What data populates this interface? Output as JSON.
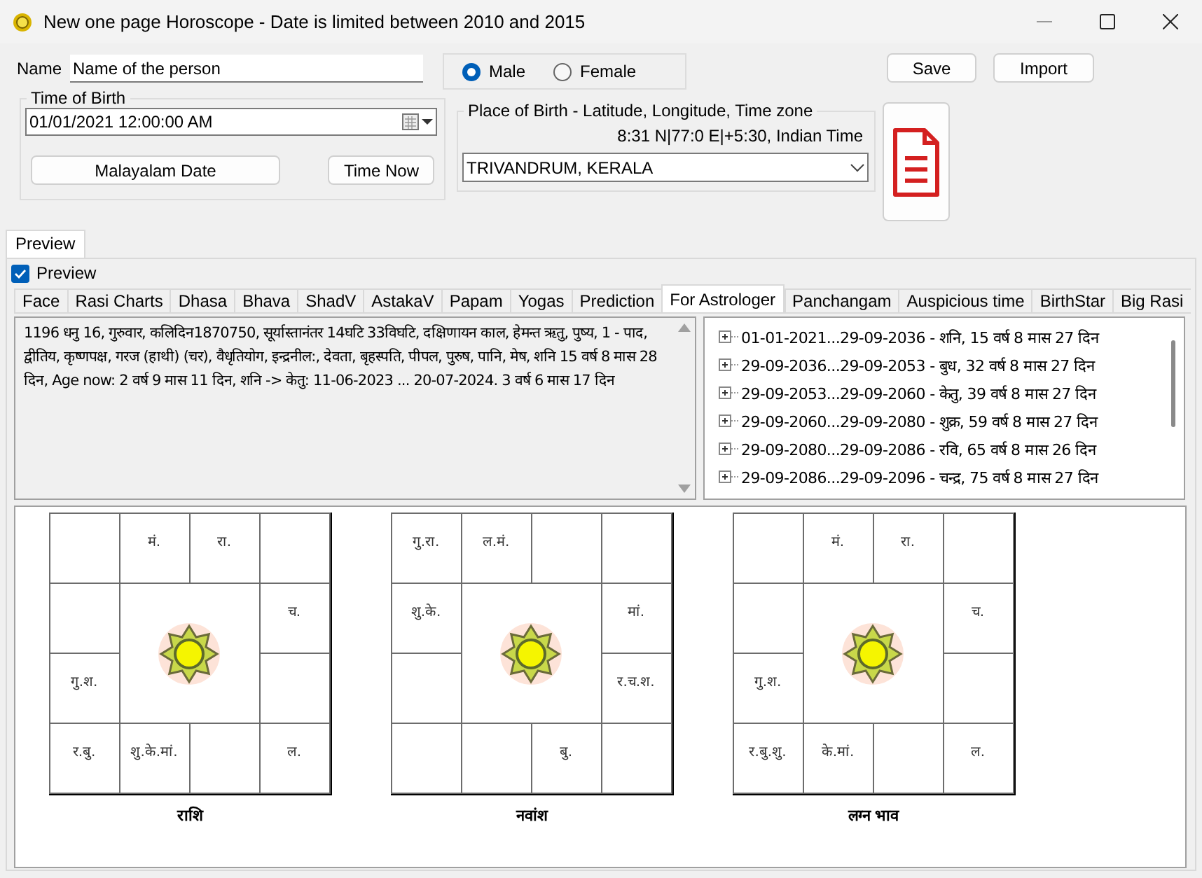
{
  "window": {
    "title": "New one page Horoscope - Date is limited between 2010 and 2015"
  },
  "name": {
    "label": "Name",
    "value": "Name of the person"
  },
  "gender": [
    {
      "label": "Male",
      "selected": true
    },
    {
      "label": "Female",
      "selected": false
    }
  ],
  "buttons": {
    "save": "Save",
    "import": "Import"
  },
  "time_of_birth": {
    "title": "Time of Birth",
    "value": "01/01/2021  12:00:00 AM",
    "malayalam_button": "Malayalam Date",
    "time_now_button": "Time Now"
  },
  "place_of_birth": {
    "title": "Place of Birth - Latitude, Longitude, Time zone",
    "coordinates": "8:31 N|77:0 E|+5:30, Indian Time",
    "place": "TRIVANDRUM, KERALA"
  },
  "outer_tabs": [
    {
      "label": "Preview",
      "selected": true
    }
  ],
  "preview_checkbox": {
    "label": "Preview",
    "checked": true
  },
  "tabs": [
    {
      "label": "Face",
      "selected": false
    },
    {
      "label": "Rasi Charts",
      "selected": false
    },
    {
      "label": "Dhasa",
      "selected": false
    },
    {
      "label": "Bhava",
      "selected": false
    },
    {
      "label": "ShadV",
      "selected": false
    },
    {
      "label": "AstakaV",
      "selected": false
    },
    {
      "label": "Papam",
      "selected": false
    },
    {
      "label": "Yogas",
      "selected": false
    },
    {
      "label": "Prediction",
      "selected": false
    },
    {
      "label": "For Astrologer",
      "selected": true
    },
    {
      "label": "Panchangam",
      "selected": false
    },
    {
      "label": "Auspicious time",
      "selected": false
    },
    {
      "label": "BirthStar",
      "selected": false
    },
    {
      "label": "Big Rasi",
      "selected": false
    }
  ],
  "summary": "1196 धनु   16, गुरुवार, कलिदिन1870750, सूर्यास्तानंतर 14घटि 33विघटि, दक्षिणायन काल, हेमन्त ऋतु, पुष्य, 1 - पाद, द्वीतिय, कृष्णपक्ष, गरज (हाथी) (चर), वैधृतियोग, इन्द्रनील:, देवता, बृहस्पति, पीपल, पुरुष, पानि, मेष, शनि 15 वर्ष 8 मास 28 दिन, Age now: 2 वर्ष 9 मास 11 दिन, शनि -> केतु: 11-06-2023 ... 20-07-2024.  3 वर्ष 6 मास 17 दिन",
  "dasha_periods": [
    {
      "text": "01-01-2021...29-09-2036 - शनि, 15 वर्ष 8 मास 27 दिन",
      "expanded": false
    },
    {
      "text": "29-09-2036...29-09-2053 - बुध, 32 वर्ष 8 मास 27 दिन",
      "expanded": false
    },
    {
      "text": "29-09-2053...29-09-2060 - केतु, 39 वर्ष 8 मास 27 दिन",
      "expanded": false
    },
    {
      "text": "29-09-2060...29-09-2080 - शुक्र, 59 वर्ष 8 मास 27 दिन",
      "expanded": false
    },
    {
      "text": "29-09-2080...29-09-2086 - रवि, 65 वर्ष 8 मास 26 दिन",
      "expanded": false
    },
    {
      "text": "29-09-2086...29-09-2096 - चन्द्र, 75 वर्ष 8 मास 27 दिन",
      "expanded": false
    }
  ],
  "charts": [
    {
      "title": "राशि",
      "cells": [
        "",
        "मं.",
        "रा.",
        "",
        "",
        "च.",
        "गु.श.",
        "",
        "र.बु.",
        "शु.के.मां.",
        "",
        "ल."
      ]
    },
    {
      "title": "नवांश",
      "cells": [
        "गु.रा.",
        "ल.मं.",
        "",
        "",
        "शु.के.",
        "मां.",
        "",
        "र.च.श.",
        "",
        "",
        "बु.",
        ""
      ]
    },
    {
      "title": "लग्न भाव",
      "cells": [
        "",
        "मं.",
        "रा.",
        "",
        "",
        "च.",
        "गु.श.",
        "",
        "र.बु.शु.",
        "के.मां.",
        "",
        "ल."
      ]
    }
  ]
}
